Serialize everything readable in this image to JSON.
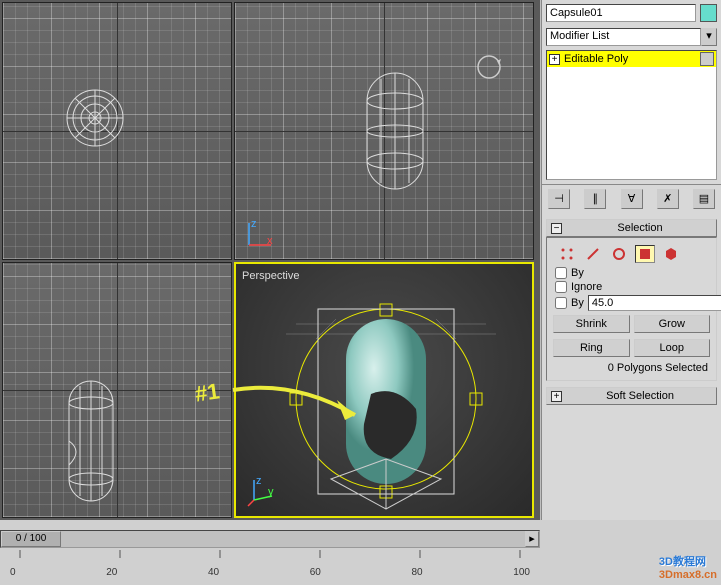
{
  "object_name": "Capsule01",
  "modifier_dropdown": "Modifier List",
  "modifier_stack": {
    "item_label": "Editable Poly"
  },
  "viewport": {
    "br_label": "Perspective"
  },
  "selection_rollout": {
    "title": "Selection",
    "by_vertex_label": "By",
    "ignore_label": "Ignore",
    "by_angle_label": "By",
    "angle_value": "45.0",
    "shrink": "Shrink",
    "grow": "Grow",
    "ring": "Ring",
    "loop": "Loop",
    "status": "0 Polygons Selected"
  },
  "soft_selection_rollout": {
    "title": "Soft Selection"
  },
  "timeline": {
    "marker": "0 / 100",
    "ticks": [
      "0",
      "20",
      "40",
      "60",
      "80",
      "100"
    ]
  },
  "annotation_text": "#1",
  "watermark": {
    "line1": "3D教程网",
    "line2": "3Dmax8.cn"
  },
  "icons": {
    "subobj_vertex": "vertex",
    "subobj_edge": "edge",
    "subobj_border": "border",
    "subobj_polygon": "polygon",
    "subobj_element": "element"
  }
}
